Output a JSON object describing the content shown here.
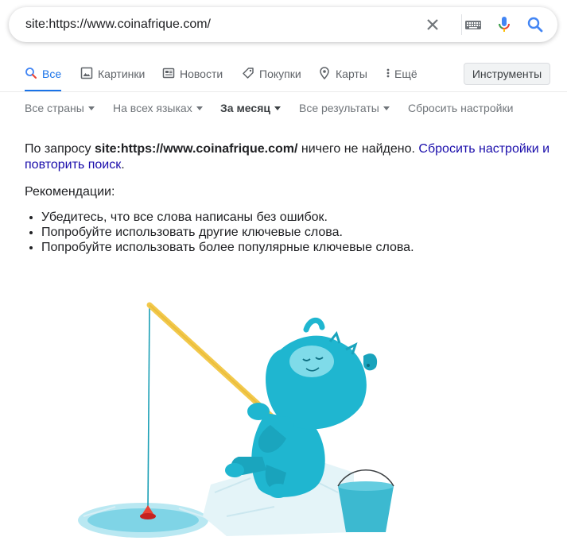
{
  "search": {
    "query": "site:https://www.coinafrique.com/",
    "icons": [
      "close-icon",
      "keyboard-icon",
      "microphone-icon",
      "search-icon"
    ]
  },
  "tabs": [
    {
      "label": "Все",
      "icon": "search-icon",
      "active": true
    },
    {
      "label": "Картинки",
      "icon": "image-icon",
      "active": false
    },
    {
      "label": "Новости",
      "icon": "news-icon",
      "active": false
    },
    {
      "label": "Покупки",
      "icon": "tag-icon",
      "active": false
    },
    {
      "label": "Карты",
      "icon": "map-pin-icon",
      "active": false
    },
    {
      "label": "Ещё",
      "icon": "more-vert-icon",
      "active": false
    }
  ],
  "tools_label": "Инструменты",
  "filters": [
    {
      "label": "Все страны",
      "dropdown": true
    },
    {
      "label": "На всех языках",
      "dropdown": true
    },
    {
      "label": "За месяц",
      "dropdown": true,
      "selected": true
    },
    {
      "label": "Все результаты",
      "dropdown": true
    },
    {
      "label": "Сбросить настройки",
      "dropdown": false
    }
  ],
  "message": {
    "prefix": "По запросу ",
    "query": "site:https://www.coinafrique.com/",
    "suffix": " ничего не найдено. ",
    "link": "Сбросить настройки и повторить поиск",
    "end": "."
  },
  "recommendations": {
    "title": "Рекомендации:",
    "items": [
      "Убедитесь, что все слова написаны без ошибок.",
      "Попробуйте использовать другие ключевые слова.",
      "Попробуйте использовать более популярные ключевые слова."
    ]
  },
  "colors": {
    "accent": "#1a73e8",
    "link": "#1a0dab",
    "mic_red": "#ea4335",
    "mic_yellow": "#fbbc04",
    "mic_green": "#34a853",
    "creature": "#1fb6d0",
    "rod": "#f2c94c"
  }
}
